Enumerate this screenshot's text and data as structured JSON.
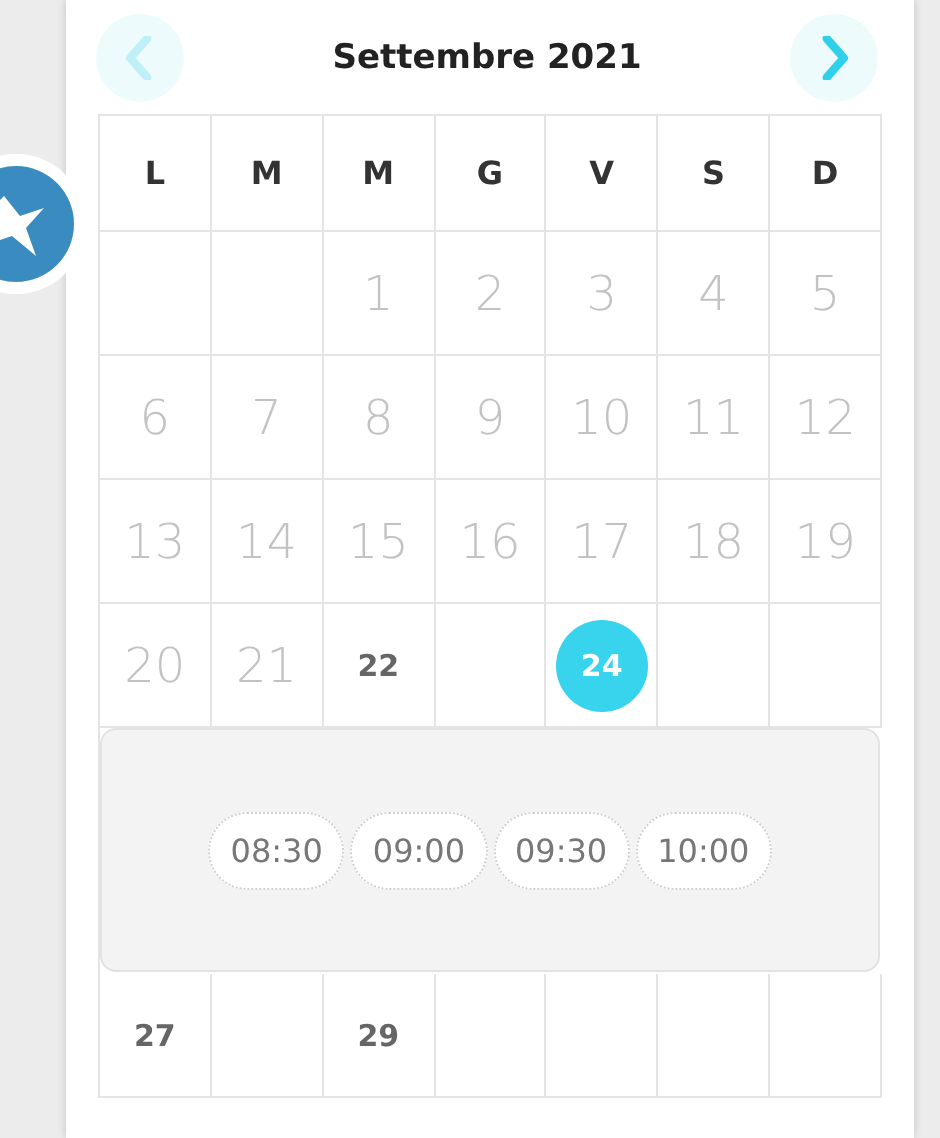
{
  "header": {
    "title": "Settembre 2021",
    "prev": {
      "disabled": true
    },
    "next": {
      "disabled": false
    }
  },
  "weekdays": [
    "L",
    "M",
    "M",
    "G",
    "V",
    "S",
    "D"
  ],
  "weeks": [
    {
      "days": [
        {
          "kind": "blank"
        },
        {
          "kind": "blank"
        },
        {
          "kind": "past",
          "label": "1",
          "selected": false
        },
        {
          "kind": "past",
          "label": "2",
          "selected": false
        },
        {
          "kind": "past",
          "label": "3",
          "selected": false
        },
        {
          "kind": "past",
          "label": "4",
          "selected": false
        },
        {
          "kind": "past",
          "label": "5",
          "selected": false
        }
      ]
    },
    {
      "days": [
        {
          "kind": "past",
          "label": "6",
          "selected": false
        },
        {
          "kind": "past",
          "label": "7",
          "selected": false
        },
        {
          "kind": "past",
          "label": "8",
          "selected": false
        },
        {
          "kind": "past",
          "label": "9",
          "selected": false
        },
        {
          "kind": "past",
          "label": "10",
          "selected": false
        },
        {
          "kind": "past",
          "label": "11",
          "selected": false
        },
        {
          "kind": "past",
          "label": "12",
          "selected": false
        }
      ]
    },
    {
      "days": [
        {
          "kind": "past",
          "label": "13",
          "selected": false
        },
        {
          "kind": "past",
          "label": "14",
          "selected": false
        },
        {
          "kind": "past",
          "label": "15",
          "selected": false
        },
        {
          "kind": "past",
          "label": "16",
          "selected": false
        },
        {
          "kind": "past",
          "label": "17",
          "selected": false
        },
        {
          "kind": "past",
          "label": "18",
          "selected": false
        },
        {
          "kind": "past",
          "label": "19",
          "selected": false
        }
      ]
    },
    {
      "days": [
        {
          "kind": "past",
          "label": "20",
          "selected": false
        },
        {
          "kind": "past",
          "label": "21",
          "selected": false
        },
        {
          "kind": "available",
          "label": "22",
          "selected": false
        },
        {
          "kind": "blank"
        },
        {
          "kind": "available",
          "label": "24",
          "selected": true
        },
        {
          "kind": "blank"
        },
        {
          "kind": "blank"
        }
      ],
      "time_slots": [
        "08:30",
        "09:00",
        "09:30",
        "10:00"
      ]
    },
    {
      "days": [
        {
          "kind": "available",
          "label": "27",
          "selected": false
        },
        {
          "kind": "blank"
        },
        {
          "kind": "available",
          "label": "29",
          "selected": false
        },
        {
          "kind": "blank"
        },
        {
          "kind": "blank"
        },
        {
          "kind": "blank"
        },
        {
          "kind": "blank"
        }
      ]
    }
  ]
}
